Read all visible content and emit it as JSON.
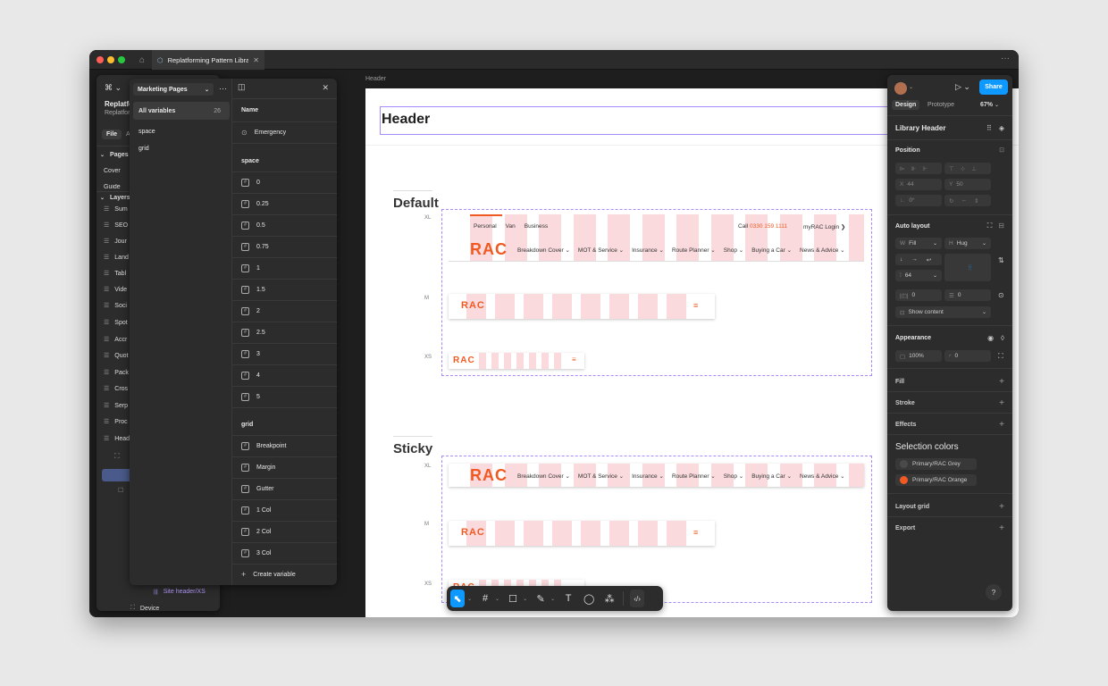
{
  "tab": {
    "title": "Replatforming Pattern Libra",
    "more": "···"
  },
  "canvas": {
    "frame_label": "Header",
    "header_title": "Header",
    "sections": {
      "default": "Default",
      "sticky": "Sticky"
    },
    "sizes": {
      "xl": "XL",
      "m": "M",
      "xs": "XS"
    },
    "rac_logo": "RAC",
    "burger": "≡",
    "top_nav": [
      "Personal",
      "Van",
      "Business"
    ],
    "call_label": "Call",
    "call_number": "0330 159 1111",
    "login": "myRAC Login",
    "login_chevron": "❯",
    "main_nav": [
      "Breakdown Cover ⌄",
      "MOT & Service ⌄",
      "Insurance ⌄",
      "Route Planner ⌄",
      "Shop ⌄",
      "Buying a Car ⌄",
      "News & Advice ⌄"
    ]
  },
  "left_panel": {
    "logo": "⌘ ⌄",
    "file_title": "Replatfo",
    "file_subtitle": "Replatfor",
    "file_tab": "File",
    "assets_tab": "A",
    "pages_label": "Pages",
    "pages": [
      "Cover",
      "Guide"
    ],
    "layers_label": "Layers",
    "layers": [
      "Sum",
      "SEO",
      "Jour",
      "Land",
      "Tabl",
      "Vide",
      "Soci",
      "Spot",
      "Accr",
      "Quot",
      "Pack",
      "Cros",
      "Serp",
      "Proc",
      "Head"
    ],
    "bottom_layers": [
      "Site header/XS",
      "Device"
    ]
  },
  "variables": {
    "collection": "Marketing Pages",
    "more": "···",
    "close": "✕",
    "groups": [
      {
        "label": "All variables",
        "count": "26"
      },
      {
        "label": "space",
        "count": ""
      },
      {
        "label": "grid",
        "count": ""
      }
    ],
    "name_header": "Name",
    "emergency": "Emergency",
    "space_label": "space",
    "space_vars": [
      "0",
      "0.25",
      "0.5",
      "0.75",
      "1",
      "1.5",
      "2",
      "2.5",
      "3",
      "4",
      "5"
    ],
    "grid_label": "grid",
    "grid_vars": [
      "Breakpoint",
      "Margin",
      "Gutter",
      "1 Col",
      "2 Col",
      "3 Col"
    ],
    "create": "Create variable"
  },
  "right_panel": {
    "avatar_caret": "⌄",
    "play": "▷ ⌄",
    "share": "Share",
    "tab_design": "Design",
    "tab_prototype": "Prototype",
    "zoom": "67%",
    "component_name": "Library Header",
    "position": {
      "label": "Position",
      "x": "44",
      "y": "50",
      "rotation": "0°"
    },
    "auto_layout": {
      "label": "Auto layout",
      "width": "Fill",
      "height": "Hug",
      "gap": "64",
      "h_pad": "0",
      "v_pad": "0",
      "show_content": "Show content"
    },
    "appearance": {
      "label": "Appearance",
      "opacity": "100%",
      "radius": "0"
    },
    "fill": "Fill",
    "stroke": "Stroke",
    "effects": "Effects",
    "selection_colors": {
      "label": "Selection colors",
      "colors": [
        {
          "name": "Primary/RAC Grey",
          "hex": "#4a4a4a"
        },
        {
          "name": "Primary/RAC Orange",
          "hex": "#f05a22"
        }
      ]
    },
    "layout_grid": "Layout grid",
    "export": "Export",
    "help": "?"
  },
  "colors": {
    "accent": "#0d99ff",
    "brand": "#f05a22",
    "selection": "#a78bfa"
  }
}
